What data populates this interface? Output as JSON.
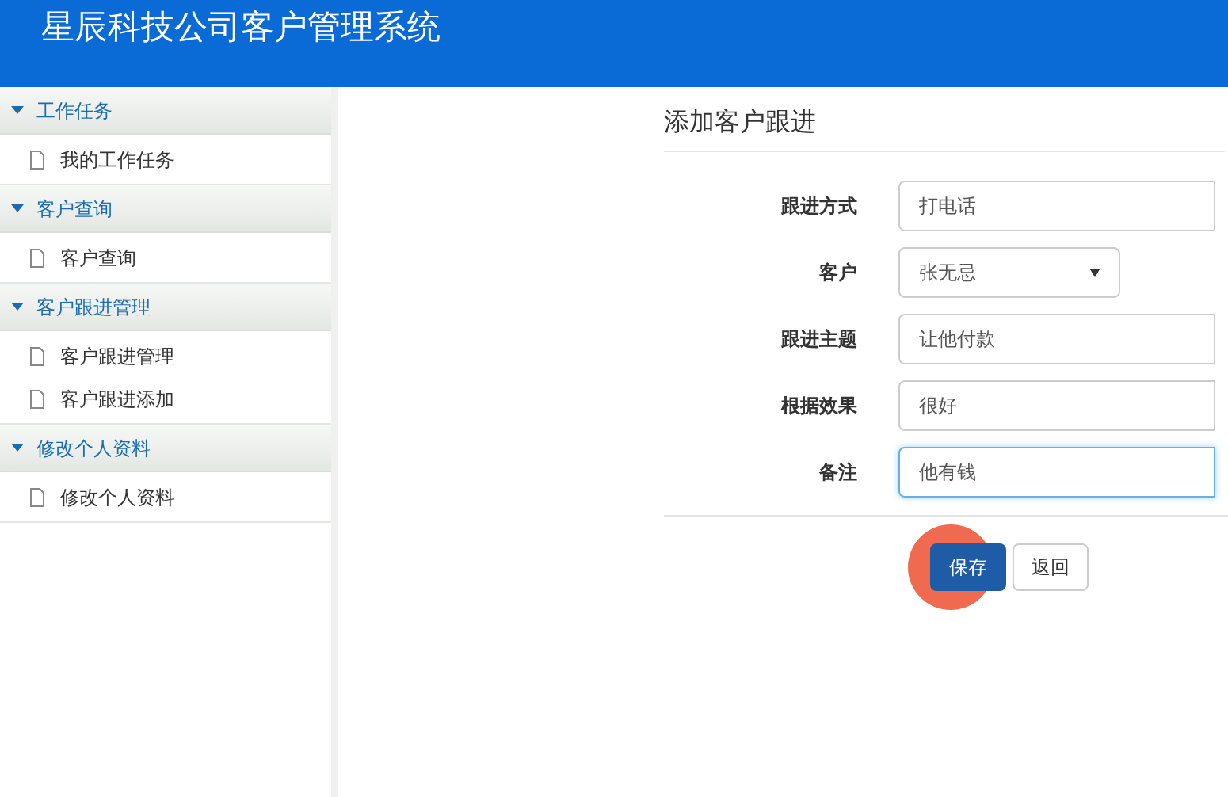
{
  "header": {
    "title": "星辰科技公司客户管理系统"
  },
  "sidebar": {
    "groups": [
      {
        "label": "工作任务",
        "expanded": true,
        "items": [
          {
            "label": "我的工作任务"
          }
        ]
      },
      {
        "label": "客户查询",
        "expanded": true,
        "items": [
          {
            "label": "客户查询"
          }
        ]
      },
      {
        "label": "客户跟进管理",
        "expanded": true,
        "items": [
          {
            "label": "客户跟进管理"
          },
          {
            "label": "客户跟进添加"
          }
        ]
      },
      {
        "label": "修改个人资料",
        "expanded": true,
        "items": [
          {
            "label": "修改个人资料"
          }
        ]
      }
    ]
  },
  "form": {
    "title": "添加客户跟进",
    "fields": [
      {
        "kind": "text",
        "label": "跟进方式",
        "value": "打电话",
        "focused": false
      },
      {
        "kind": "select",
        "label": "客户",
        "value": "张无忌",
        "focused": false
      },
      {
        "kind": "text",
        "label": "跟进主题",
        "value": "让他付款",
        "focused": false
      },
      {
        "kind": "text",
        "label": "根据效果",
        "value": "很好",
        "focused": false
      },
      {
        "kind": "text",
        "label": "备注",
        "value": "他有钱",
        "focused": true
      }
    ],
    "buttons": [
      {
        "kind": "primary",
        "label": "保存",
        "clicked": true
      },
      {
        "kind": "default",
        "label": "返回",
        "clicked": false
      }
    ]
  }
}
